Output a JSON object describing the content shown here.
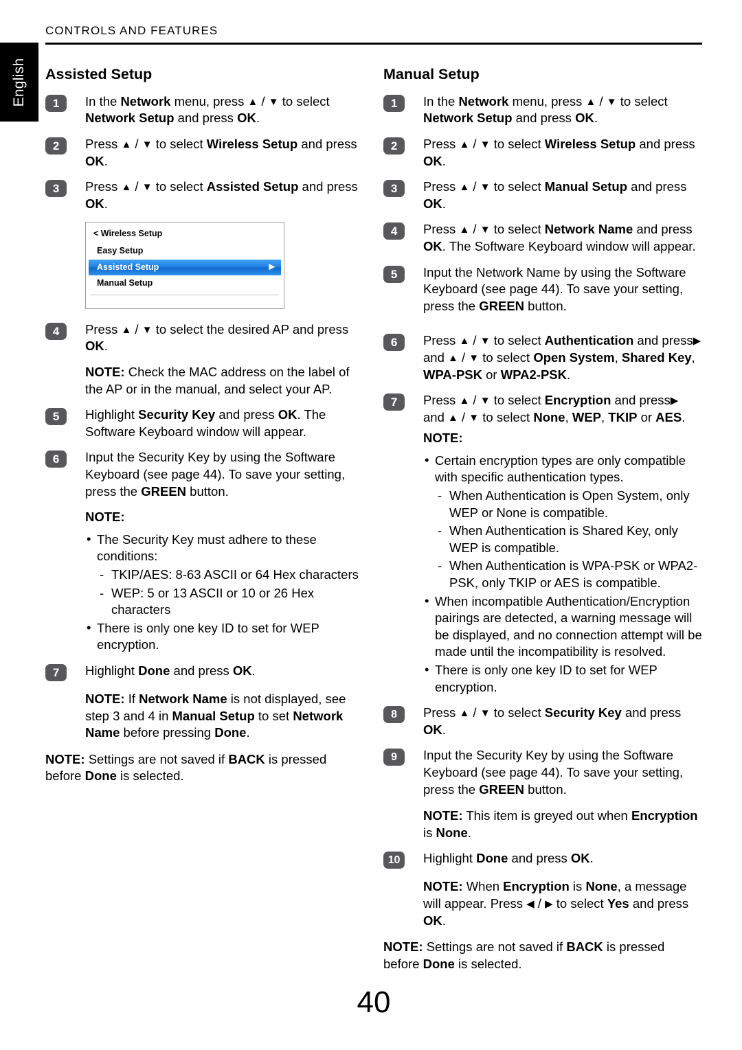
{
  "language_tab": "English",
  "running_head": "CONTROLS AND FEATURES",
  "page_number": "40",
  "colors": {
    "badge": "#58585a",
    "osd_highlight": "#1f7fe0",
    "language_tab_bg": "#000000"
  },
  "left_column": {
    "title": "Assisted Setup",
    "steps": [
      {
        "num": "1",
        "text_html": "In the <b>Network</b> menu, press <span class=\"ar\">▲</span> / <span class=\"ar\">▼</span> to select <b>Network Setup</b> and press <b>OK</b>."
      },
      {
        "num": "2",
        "text_html": "Press <span class=\"ar\">▲</span> / <span class=\"ar\">▼</span> to select <b>Wireless Setup</b> and press <b>OK</b>."
      },
      {
        "num": "3",
        "text_html": "Press <span class=\"ar\">▲</span> / <span class=\"ar\">▼</span> to select <b>Assisted Setup</b> and press <b>OK</b>."
      }
    ],
    "osd": {
      "breadcrumb": "< Wireless Setup",
      "items": [
        {
          "label": "Easy Setup",
          "selected": false
        },
        {
          "label": "Assisted Setup",
          "selected": true
        },
        {
          "label": "Manual Setup",
          "selected": false
        }
      ],
      "caret": "▶"
    },
    "steps2": [
      {
        "num": "4",
        "text_html": "Press <span class=\"ar\">▲</span> / <span class=\"ar\">▼</span> to select the desired AP and press <b>OK</b>."
      }
    ],
    "note_mac_html": "<b>NOTE:</b> Check the MAC address on the label of the AP or in the manual, and select your AP.",
    "steps3": [
      {
        "num": "5",
        "text_html": "Highlight <b>Security Key</b> and press <b>OK</b>. The Software Keyboard window will appear."
      },
      {
        "num": "6",
        "text_html": "Input the Security Key by using the Software Keyboard (see page 44). To save your setting, press the <b>GREEN</b> button."
      }
    ],
    "note_label": "NOTE:",
    "note_bullets": [
      "The Security Key must adhere to these conditions:"
    ],
    "note_dashes": [
      "TKIP/AES: 8-63 ASCII or 64 Hex characters",
      "WEP: 5 or 13 ASCII or 10 or 26 Hex characters"
    ],
    "note_bullets2": [
      "There is only one key ID to set for WEP encryption."
    ],
    "steps4": [
      {
        "num": "7",
        "text_html": "Highlight <b>Done</b> and press <b>OK</b>."
      }
    ],
    "note_network_name_html": "<b>NOTE:</b> If <b>Network Name</b> is not displayed, see step 3 and 4 in <b>Manual Setup</b> to set <b>Network Name</b> before pressing <b>Done</b>.",
    "note_back_html": "<b>NOTE:</b> Settings are not saved if <b>BACK</b> is pressed before <b>Done</b> is selected."
  },
  "right_column": {
    "title": "Manual Setup",
    "steps": [
      {
        "num": "1",
        "text_html": "In the <b>Network</b> menu, press <span class=\"ar\">▲</span> / <span class=\"ar\">▼</span> to select <b>Network Setup</b> and press <b>OK</b>."
      },
      {
        "num": "2",
        "text_html": "Press <span class=\"ar\">▲</span> / <span class=\"ar\">▼</span> to select <b>Wireless Setup</b> and press <b>OK</b>."
      },
      {
        "num": "3",
        "text_html": "Press <span class=\"ar\">▲</span> / <span class=\"ar\">▼</span> to select <b>Manual Setup</b> and press <b>OK</b>."
      },
      {
        "num": "4",
        "text_html": "Press <span class=\"ar\">▲</span> / <span class=\"ar\">▼</span> to select <b>Network Name</b> and press <b>OK</b>. The Software Keyboard window will appear."
      },
      {
        "num": "5",
        "text_html": "Input the Network Name by using the Software Keyboard (see page 44). To save your setting, press the <b>GREEN</b> button."
      },
      {
        "num": "6",
        "text_html": "Press <span class=\"ar\">▲</span> / <span class=\"ar\">▼</span> to select <b>Authentication</b> and press<span class=\"ar\">▶</span> and <span class=\"ar\">▲</span> / <span class=\"ar\">▼</span> to select <b>Open System</b>, <b>Shared Key</b>, <b>WPA-PSK</b> or <b>WPA2-PSK</b>."
      },
      {
        "num": "7",
        "text_html": "Press <span class=\"ar\">▲</span> / <span class=\"ar\">▼</span> to select <b>Encryption</b> and press<span class=\"ar\">▶</span> and <span class=\"ar\">▲</span> / <span class=\"ar\">▼</span> to select <b>None</b>, <b>WEP</b>, <b>TKIP</b> or <b>AES</b>."
      }
    ],
    "note_label": "NOTE:",
    "note_bullet_1": "Certain encryption types are only compatible with specific authentication types.",
    "note_dashes": [
      "When Authentication is Open System, only WEP or None is compatible.",
      "When Authentication is Shared Key, only WEP is compatible.",
      "When Authentication is WPA-PSK or WPA2-PSK, only TKIP or AES is compatible."
    ],
    "note_bullets2": [
      "When incompatible Authentication/Encryption pairings are detected, a warning message will be displayed, and no connection attempt will be made until the incompatibility is resolved.",
      "There is only one key ID to set for WEP encryption."
    ],
    "steps2": [
      {
        "num": "8",
        "text_html": "Press <span class=\"ar\">▲</span> / <span class=\"ar\">▼</span> to select <b>Security Key</b> and press <b>OK</b>."
      },
      {
        "num": "9",
        "text_html": "Input the Security Key by using the Software Keyboard (see page 44). To save your setting, press the <b>GREEN</b> button."
      }
    ],
    "note_greyed_html": "<b>NOTE:</b> This item is greyed out when <b>Encryption</b> is <b>None</b>.",
    "steps3": [
      {
        "num": "10",
        "text_html": "Highlight <b>Done</b> and press <b>OK</b>."
      }
    ],
    "note_none_msg_html": "<b>NOTE:</b> When <b>Encryption</b> is <b>None</b>, a message will appear. Press <span class=\"ar\">◀</span> / <span class=\"ar\">▶</span> to select <b>Yes</b> and press <b>OK</b>.",
    "note_back_html": "<b>NOTE:</b> Settings are not saved if <b>BACK</b> is pressed before <b>Done</b> is selected."
  }
}
